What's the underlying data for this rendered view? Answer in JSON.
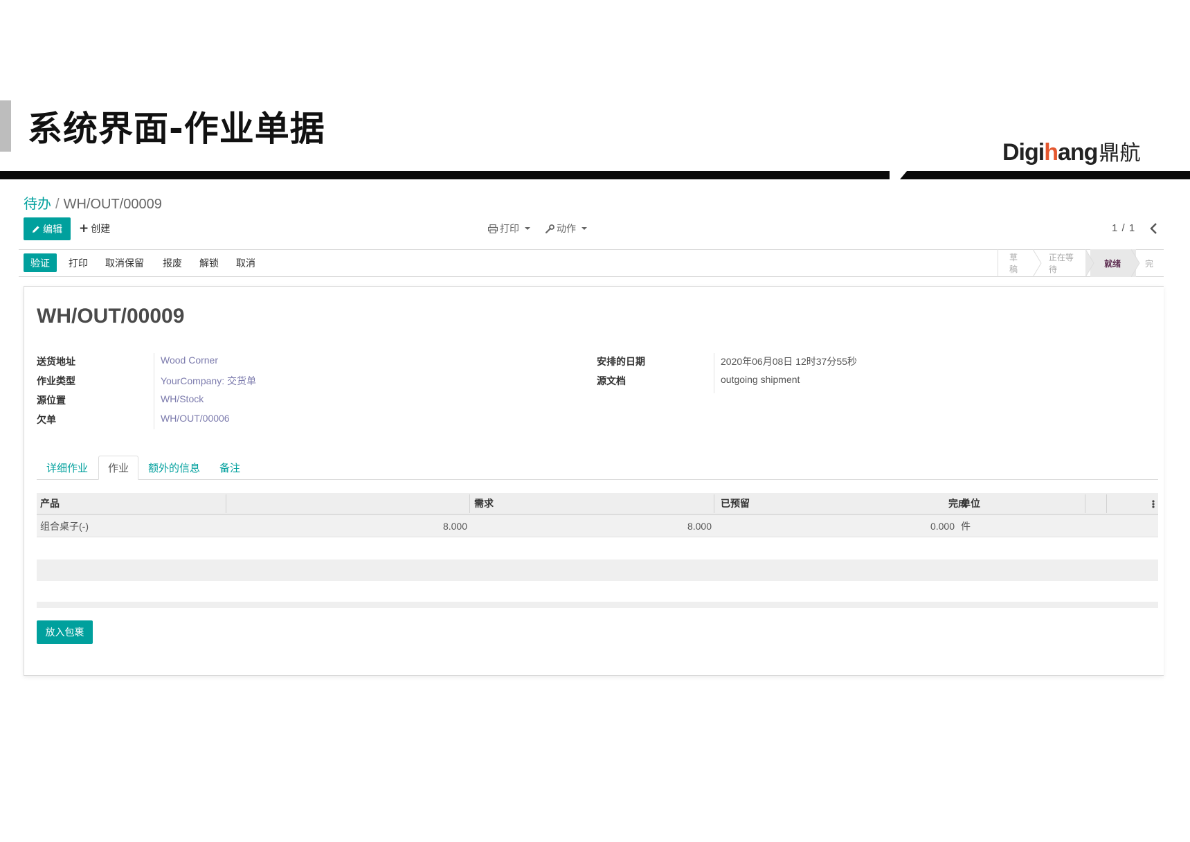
{
  "slide": {
    "title": "系统界面-作业单据",
    "brand_prefix": "Digi",
    "brand_accent": "h",
    "brand_suffix": "ang",
    "brand_cn": "鼎航"
  },
  "breadcrumb": {
    "parent": "待办",
    "current": "WH/OUT/00009"
  },
  "control": {
    "edit_label": "编辑",
    "create_label": "创建",
    "print_label": "打印",
    "action_label": "动作",
    "pager": "1 / 1"
  },
  "status_actions": {
    "validate": "验证",
    "print": "打印",
    "unreserve": "取消保留",
    "scrap": "报废",
    "unlock": "解锁",
    "cancel": "取消"
  },
  "stages": [
    "草稿",
    "正在等待",
    "就绪",
    "完"
  ],
  "record": {
    "name": "WH/OUT/00009",
    "fields_left": [
      {
        "label": "送货地址",
        "value": "Wood Corner"
      },
      {
        "label": "作业类型",
        "value": "YourCompany: 交货单"
      },
      {
        "label": "源位置",
        "value": "WH/Stock"
      },
      {
        "label": "欠单",
        "value": "WH/OUT/00006"
      }
    ],
    "fields_right": [
      {
        "label": "安排的日期",
        "value": "2020年06月08日 12时37分55秒"
      },
      {
        "label": "源文档",
        "value": "outgoing shipment"
      }
    ]
  },
  "tabs": [
    "详细作业",
    "作业",
    "额外的信息",
    "备注"
  ],
  "table": {
    "headers": [
      "产品",
      "需求",
      "已预留",
      "完成",
      "单位"
    ],
    "rows": [
      [
        "组合桌子(-)",
        "8.000",
        "8.000",
        "0.000",
        "件"
      ]
    ]
  },
  "put_in_pack": "放入包裹",
  "colors": {
    "accent": "#00a09d",
    "link": "#7c7bad",
    "current_stage": "#5c2b4f"
  }
}
